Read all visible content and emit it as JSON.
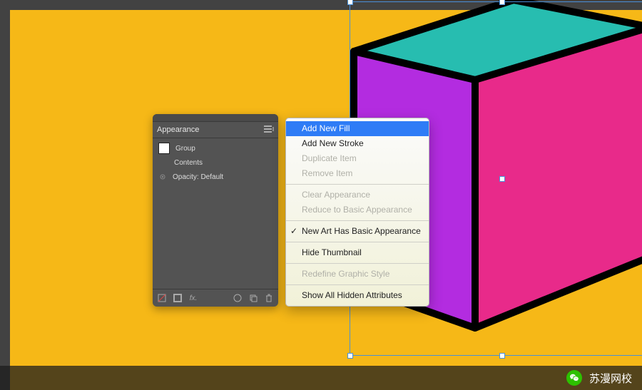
{
  "panel": {
    "title": "Appearance",
    "rows": {
      "group": "Group",
      "contents": "Contents",
      "opacity": "Opacity: Default"
    },
    "footer_icons": [
      "no-fill",
      "stroke",
      "fx",
      "clear",
      "duplicate",
      "trash"
    ]
  },
  "menu": {
    "items": [
      {
        "label": "Add New Fill",
        "state": "selected"
      },
      {
        "label": "Add New Stroke",
        "state": "normal"
      },
      {
        "label": "Duplicate Item",
        "state": "disabled"
      },
      {
        "label": "Remove Item",
        "state": "disabled"
      },
      {
        "sep": true
      },
      {
        "label": "Clear Appearance",
        "state": "disabled"
      },
      {
        "label": "Reduce to Basic Appearance",
        "state": "disabled"
      },
      {
        "sep": true
      },
      {
        "label": "New Art Has Basic Appearance",
        "state": "checked"
      },
      {
        "sep": true
      },
      {
        "label": "Hide Thumbnail",
        "state": "normal"
      },
      {
        "sep": true
      },
      {
        "label": "Redefine Graphic Style",
        "state": "disabled"
      },
      {
        "sep": true
      },
      {
        "label": "Show All Hidden Attributes",
        "state": "normal"
      }
    ]
  },
  "cube": {
    "colors": {
      "top": "#27bdb0",
      "left": "#b32ce0",
      "right": "#e82a8a",
      "edge": "#000000"
    },
    "selection_color": "#4a90d9"
  },
  "overlay": {
    "text": "苏漫网校",
    "icon": "wechat-icon"
  }
}
